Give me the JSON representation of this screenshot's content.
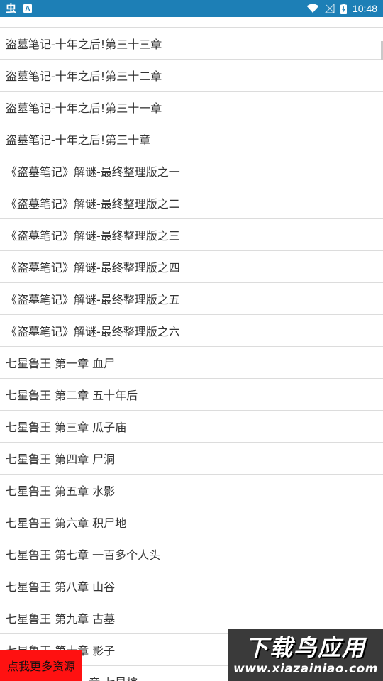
{
  "status_bar": {
    "app_glyph": "虫",
    "a_badge": "A",
    "time": "10:48",
    "background": "#1d7fb6"
  },
  "chapters": [
    "盗墓笔记-十年之后!第三十三章",
    "盗墓笔记-十年之后!第三十二章",
    "盗墓笔记-十年之后!第三十一章",
    "盗墓笔记-十年之后!第三十章",
    "《盗墓笔记》解谜-最终整理版之一",
    "《盗墓笔记》解谜-最终整理版之二",
    "《盗墓笔记》解谜-最终整理版之三",
    "《盗墓笔记》解谜-最终整理版之四",
    "《盗墓笔记》解谜-最终整理版之五",
    "《盗墓笔记》解谜-最终整理版之六",
    "七星鲁王 第一章 血尸",
    "七星鲁王 第二章 五十年后",
    "七星鲁王 第三章 瓜子庙",
    "七星鲁王 第四章 尸洞",
    "七星鲁王 第五章 水影",
    "七星鲁王 第六章 积尸地",
    "七星鲁王 第七章 一百多个人头",
    "七星鲁王 第八章 山谷",
    "七星鲁王 第九章 古墓",
    "七星鲁王 第十章 影子",
    "七星鲁王 第十一章 七星棺"
  ],
  "more_button": {
    "label": "点我更多资源",
    "color": "#ff1111"
  },
  "watermark": {
    "title": "下载鸟应用",
    "url": "www.xiazainiao.com"
  }
}
